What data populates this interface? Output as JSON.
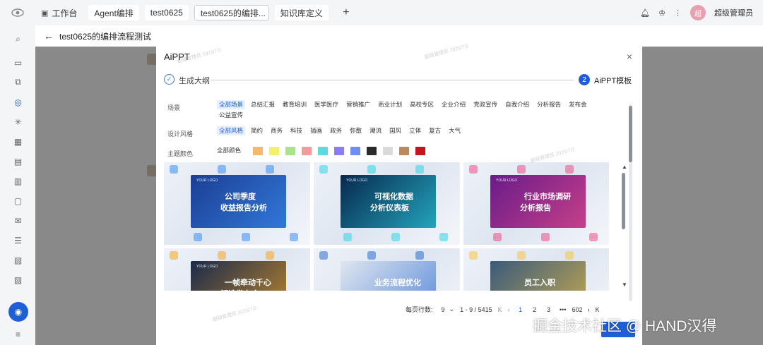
{
  "topbar": {
    "tabs": [
      {
        "label": "工作台",
        "icon": "monitor-icon"
      },
      {
        "label": "Agent编排"
      },
      {
        "label": "test0625"
      },
      {
        "label": "test0625的编排..."
      },
      {
        "label": "知识库定义"
      }
    ],
    "add_tab": "+",
    "user_name": "超级管理员",
    "avatar_text": "超"
  },
  "page": {
    "back_icon": "←",
    "title": "test0625的编排流程测试"
  },
  "modal": {
    "title": "AiPPT",
    "close": "×",
    "steps": [
      {
        "index": "✓",
        "label": "生成大纲",
        "state": "done"
      },
      {
        "index": "2",
        "label": "AiPPT模板",
        "state": "active"
      }
    ],
    "filters": {
      "scene": {
        "label": "场景",
        "options": [
          "全部场景",
          "总结汇报",
          "教育培训",
          "医学医疗",
          "营销推广",
          "商业计划",
          "高校专区",
          "企业介绍",
          "党政宣传",
          "自我介绍",
          "分析报告",
          "发布会",
          "公益宣传"
        ],
        "selected": "全部场景"
      },
      "style": {
        "label": "设计风格",
        "options": [
          "全部风格",
          "简约",
          "商务",
          "科技",
          "插画",
          "政务",
          "弥散",
          "潮流",
          "国风",
          "立体",
          "复古",
          "大气"
        ],
        "selected": "全部风格"
      },
      "color": {
        "label": "主题颜色",
        "all_label": "全部颜色",
        "swatches": [
          "#f5b96a",
          "#f4f06a",
          "#a8e38d",
          "#f49a9a",
          "#5fd8e0",
          "#8b7cf6",
          "#6f8ff0",
          "#2b2b2b",
          "#d9d9d9",
          "#b98a5e",
          "#c4151c"
        ]
      }
    },
    "templates": [
      {
        "logo": "YOUR LOGO",
        "line1": "公司季度",
        "line2": "收益报告分析",
        "theme": "#1b3f93",
        "accent": "#3a8ef5"
      },
      {
        "logo": "YOUR LOGO",
        "line1": "可视化数据",
        "line2": "分析仪表板",
        "theme": "#06284d",
        "accent": "#2fd6e8"
      },
      {
        "logo": "YOUR LOGO",
        "line1": "行业市场调研",
        "line2": "分析报告",
        "theme": "#6a1b8a",
        "accent": "#e94f87"
      },
      {
        "logo": "YOUR LOGO",
        "line1": "一帧牵动千心",
        "line2": "解读发布会",
        "theme": "#1a2a4a",
        "accent": "#f5a623"
      },
      {
        "logo": "",
        "line1": "业务流程优化",
        "line2": "",
        "theme": "#dfe6f0",
        "accent": "#2c6bd1"
      },
      {
        "logo": "",
        "line1": "员工入职",
        "line2": "",
        "theme": "#3a5a7a",
        "accent": "#f5c542"
      }
    ],
    "pagination": {
      "page_size_label": "每页行数:",
      "page_size": "9",
      "range": "1 - 9 / 5415",
      "pages": [
        "1",
        "2",
        "3",
        "•••",
        "602"
      ],
      "current": "1"
    }
  },
  "watermark_text": "超级管理员 2025/7/2",
  "credit": "掘金技术社区 @ HAND汉得"
}
